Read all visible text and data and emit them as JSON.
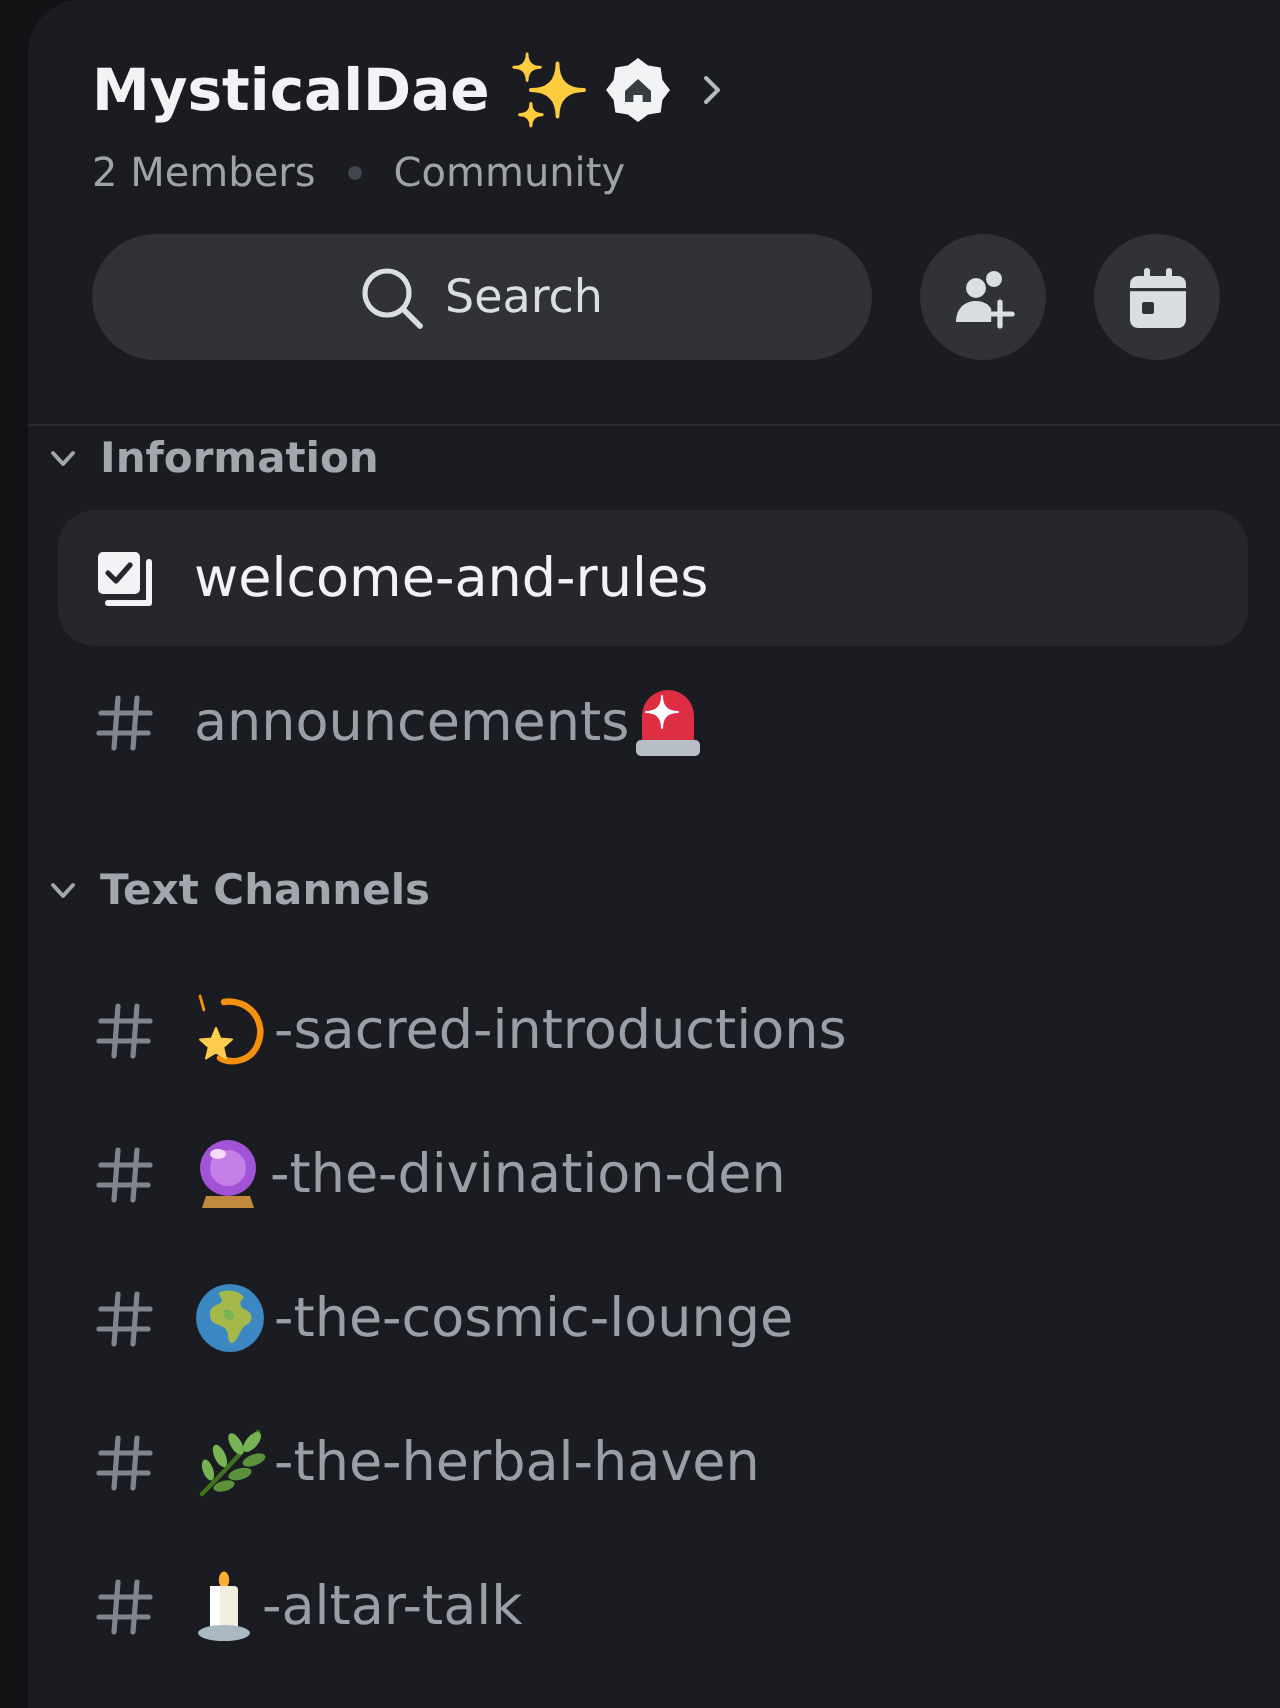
{
  "server": {
    "name": "MysticalDae",
    "members": "2 Members",
    "type": "Community"
  },
  "toolbar": {
    "search": "Search"
  },
  "categories": [
    {
      "name": "Information",
      "expanded": true,
      "channels": [
        {
          "kind": "rules",
          "name": "welcome-and-rules",
          "selected": true
        },
        {
          "kind": "text",
          "name": "announcements",
          "emoji_first": false,
          "selected": false
        }
      ]
    },
    {
      "name": "Text Channels",
      "expanded": true,
      "channels": [
        {
          "kind": "text",
          "name": "-sacred-introductions",
          "emoji_first": true,
          "selected": false
        },
        {
          "kind": "text",
          "name": "-the-divination-den",
          "emoji_first": true,
          "selected": false
        },
        {
          "kind": "text",
          "name": "-the-cosmic-lounge",
          "emoji_first": true,
          "selected": false
        },
        {
          "kind": "text",
          "name": "-the-herbal-haven",
          "emoji_first": true,
          "selected": false
        },
        {
          "kind": "text",
          "name": "-altar-talk",
          "emoji_first": true,
          "selected": false
        }
      ]
    }
  ]
}
